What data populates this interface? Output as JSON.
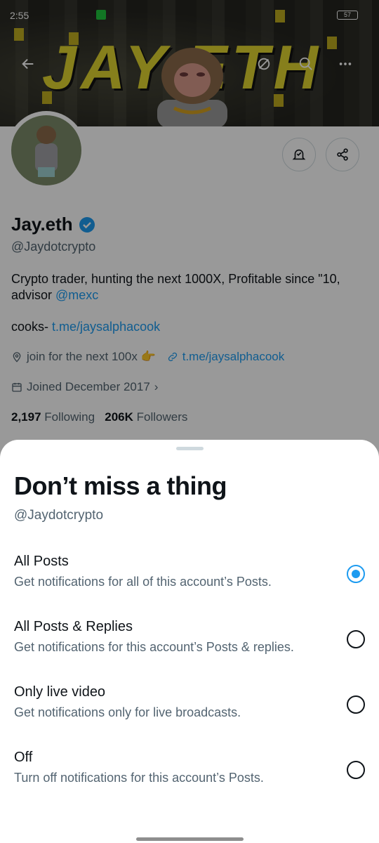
{
  "status_bar": {
    "time": "2:55",
    "battery": "57"
  },
  "banner": {
    "title": "JAY.ETH"
  },
  "top_bar": {
    "back_icon": "arrow-left-icon",
    "grok_icon": "slashed-circle-icon",
    "search_icon": "search-icon",
    "more_icon": "ellipsis-icon"
  },
  "profile": {
    "name": "Jay.eth",
    "handle": "@Jaydotcrypto",
    "bio_text": "Crypto trader, hunting the next 1000X, Profitable since \"10, advisor ",
    "bio_mention": "@mexc",
    "cooks_prefix": "cooks-",
    "cooks_link": "t.me/jaysalphacook",
    "location": "join for the next 100x 👉",
    "website": "t.me/jaysalphacook",
    "joined": "Joined December 2017",
    "following_count": "2,197",
    "following_label": "Following",
    "followers_count": "206K",
    "followers_label": "Followers"
  },
  "sheet": {
    "title": "Don’t miss a thing",
    "handle": "@Jaydotcrypto",
    "selected_index": 0,
    "options": [
      {
        "label": "All Posts",
        "description": "Get notifications for all of this account’s Posts."
      },
      {
        "label": "All Posts & Replies",
        "description": "Get notifications for this account’s Posts & replies."
      },
      {
        "label": "Only live video",
        "description": "Get notifications only for live broadcasts."
      },
      {
        "label": "Off",
        "description": "Turn off notifications for this account’s Posts."
      }
    ]
  },
  "colors": {
    "accent": "#1d9bf0",
    "text": "#0f1419",
    "secondary": "#536471",
    "banner_yellow": "#e0d430"
  }
}
